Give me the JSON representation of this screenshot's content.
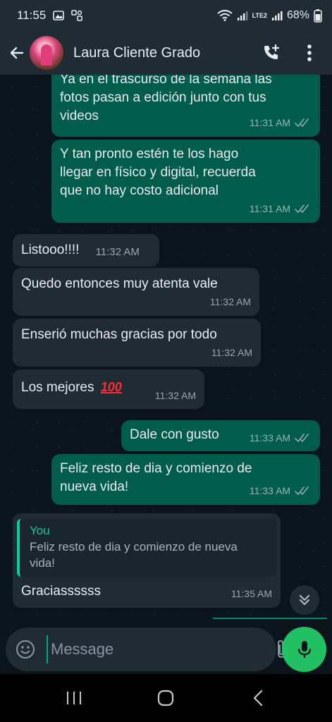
{
  "status_bar": {
    "time": "11:55",
    "battery": "68%",
    "network": "LTE2"
  },
  "header": {
    "contact_name": "Laura Cliente Grado"
  },
  "messages": [
    {
      "direction": "out",
      "text": "Ya en el trascurso de la semana las\nfotos pasan a edición junto con tus\nvideos",
      "time": "11:31 AM",
      "read": true
    },
    {
      "direction": "out",
      "text": "Y tan pronto estén te los hago\nllegar en físico y digital, recuerda\nque no hay costo adicional",
      "time": "11:31 AM",
      "read": true
    },
    {
      "direction": "in",
      "text": "Listooo!!!!",
      "time": "11:32 AM"
    },
    {
      "direction": "in",
      "text": "Quedo entonces muy atenta vale",
      "time": "11:32 AM"
    },
    {
      "direction": "in",
      "text": "Enserió muchas gracias por todo",
      "time": "11:32 AM"
    },
    {
      "direction": "in",
      "text": "Los mejores",
      "emoji": "100",
      "time": "11:32 AM"
    },
    {
      "direction": "out",
      "text": "Dale con gusto",
      "time": "11:33 AM",
      "read": true
    },
    {
      "direction": "out",
      "text": "Feliz resto de dia y comienzo de\nnueva vida!",
      "time": "11:33 AM",
      "read": true
    },
    {
      "direction": "in",
      "reply_to": {
        "author": "You",
        "text": "Feliz resto de dia y comienzo de nueva\nvida!"
      },
      "text": "Graciassssss",
      "time": "11:35 AM"
    }
  ],
  "input": {
    "placeholder": "Message"
  },
  "colors": {
    "outgoing_bubble": "#005c4b",
    "incoming_bubble": "#1f2c34",
    "accent": "#21c063",
    "read_ticks": "#8fa3ad"
  },
  "icons": [
    "back-arrow-icon",
    "add-call-icon",
    "more-options-icon",
    "emoji-icon",
    "attach-icon",
    "camera-icon",
    "mic-icon",
    "scroll-down-icon",
    "recents-icon",
    "home-icon",
    "nav-back-icon"
  ]
}
